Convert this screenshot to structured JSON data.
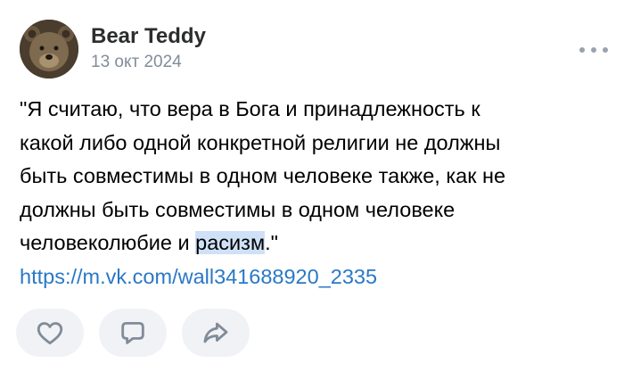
{
  "post": {
    "author": "Bear Teddy",
    "date": "13 окт 2024",
    "text_before": "\"Я считаю, что вера в Бога и принадлежность к\nкакой либо одной конкретной религии не должны\nбыть совместимы в одном человеке также, как не\nдолжны быть совместимы в одном человеке\nчеловеколюбие и ",
    "text_highlight": "расизм",
    "text_after": ".\"",
    "link": "https://m.vk.com/wall341688920_2335"
  },
  "actions": {
    "icons": [
      "heart-icon",
      "comment-icon",
      "share-icon"
    ]
  },
  "colors": {
    "link": "#2a78c5",
    "secondary_text": "#818c99",
    "button_bg": "#f0f2f5",
    "highlight": "#cfe1f7"
  }
}
